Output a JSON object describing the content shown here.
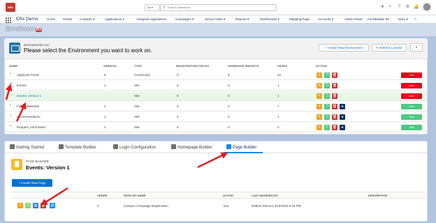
{
  "topbar": {
    "search_scope": "All",
    "search_placeholder": "Search Salesforce",
    "icons": [
      "star-icon",
      "add-icon",
      "help-icon",
      "setup-gear-icon",
      "notification-bell-icon",
      "avatar"
    ]
  },
  "nav": {
    "app_name": "ERx Demo",
    "items": [
      "Home",
      "Pardot",
      "Contacts",
      "Applications",
      "Assigned Applications",
      "Campaigns",
      "School Visits",
      "Reports",
      "Dashboards",
      "Mapping Page",
      "Accounts",
      "Admin Panel",
      "FormBuilder Rx",
      "More"
    ]
  },
  "brand": {
    "name": "Enrollment",
    "suffix": "Rx"
  },
  "env": {
    "breadcrumb": "Environments List",
    "title": "Please select the Environment you want to work on.",
    "create_button": "Create New Environment",
    "refresh_button": "Refresh License",
    "columns": [
      "NAME",
      "VERSION",
      "TYPE",
      "REGISTRATION FIELDS",
      "HOMEPAGE WIDGETS",
      "PAGES",
      "ACTION"
    ],
    "rows": [
      {
        "name": "Applicant Portal",
        "version": "6",
        "type": "Community",
        "reg": "9",
        "widgets": "5",
        "pages": "10",
        "status": "Live"
      },
      {
        "name": "Events",
        "version": "1",
        "type": "Site",
        "reg": "5",
        "widgets": "0",
        "pages": "1",
        "status": "Live"
      },
      {
        "name": "Events: Version 1",
        "version": "",
        "type": "Site",
        "reg": "5",
        "widgets": "0",
        "pages": "1",
        "status": "Live"
      },
      {
        "name": "FormBuilderSite",
        "version": "2",
        "type": "Site",
        "reg": "5",
        "widgets": "0",
        "pages": "7",
        "status": "Test"
      },
      {
        "name": "recommendation",
        "version": "1",
        "type": "Site",
        "reg": "5",
        "widgets": "0",
        "pages": "1",
        "status": "Test"
      },
      {
        "name": "Request_Information",
        "version": "2",
        "type": "Site",
        "reg": "5",
        "widgets": "0",
        "pages": "3",
        "status": "Test"
      }
    ],
    "colors": {
      "live": "#ea001e",
      "test": "#4bca81",
      "selected_row": "#e9f8e6"
    }
  },
  "tabs": [
    "Getting Started",
    "Template Builder",
    "Login Configuration",
    "Homepage Builder",
    "Page Builder"
  ],
  "page_builder": {
    "breadcrumb": "PAGE BUILDER",
    "title": "Events: Version 1",
    "new_button": "+ Create New Page",
    "columns": [
      "ORDER",
      "PAGE API NAME",
      "ACTIVE",
      "LAST MODIFIED BY",
      "DESCRIPTION"
    ],
    "row": {
      "order": "2",
      "api_name": "Campus Campaign Registration",
      "active": "true",
      "modified": "Debbie Director 3/19/2020 5:18 PM",
      "description": ""
    }
  }
}
